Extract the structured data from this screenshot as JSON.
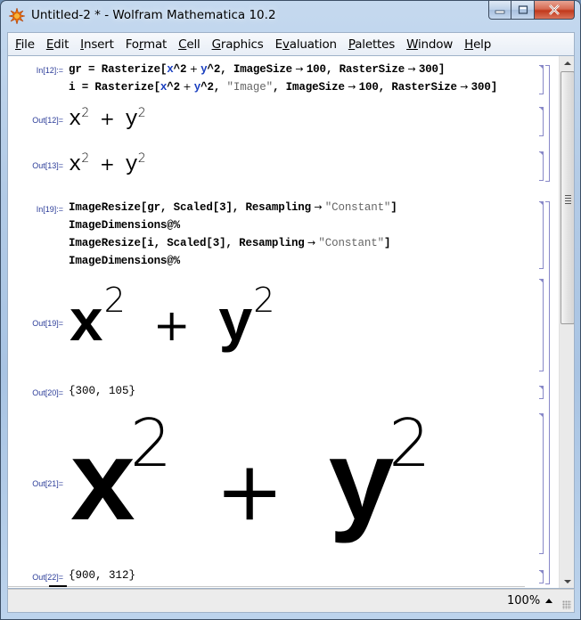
{
  "window": {
    "title": "Untitled-2 * - Wolfram Mathematica 10.2",
    "app_icon": "mathematica-spikey-icon",
    "controls": [
      "minimize",
      "maximize",
      "close"
    ]
  },
  "menubar": {
    "items": [
      {
        "label": "File",
        "mnemonic": "F"
      },
      {
        "label": "Edit",
        "mnemonic": "E"
      },
      {
        "label": "Insert",
        "mnemonic": "I"
      },
      {
        "label": "Format",
        "mnemonic": "r"
      },
      {
        "label": "Cell",
        "mnemonic": "C"
      },
      {
        "label": "Graphics",
        "mnemonic": "G"
      },
      {
        "label": "Evaluation",
        "mnemonic": "v"
      },
      {
        "label": "Palettes",
        "mnemonic": "P"
      },
      {
        "label": "Window",
        "mnemonic": "W"
      },
      {
        "label": "Help",
        "mnemonic": "H"
      }
    ]
  },
  "notebook": {
    "cells": {
      "in12": {
        "label": "In[12]:=",
        "lines": [
          "gr = Rasterize[x^2 + y^2, ImageSize → 100, RasterSize → 300]",
          "i = Rasterize[x^2 + y^2, \"Image\", ImageSize → 100, RasterSize → 300]"
        ]
      },
      "out12": {
        "label": "Out[12]=",
        "expr": "x^2 + y^2",
        "var1": "x",
        "var2": "y",
        "exp": "2",
        "plus": "+"
      },
      "out13": {
        "label": "Out[13]=",
        "expr": "x^2 + y^2",
        "var1": "x",
        "var2": "y",
        "exp": "2",
        "plus": "+"
      },
      "in19": {
        "label": "In[19]:=",
        "lines": [
          "ImageResize[gr, Scaled[3], Resampling → \"Constant\"]",
          "ImageDimensions@%",
          "ImageResize[i, Scaled[3], Resampling → \"Constant\"]",
          "ImageDimensions@%"
        ]
      },
      "out19": {
        "label": "Out[19]=",
        "expr": "x^2 + y^2",
        "var1": "x",
        "var2": "y",
        "exp": "2",
        "plus": "+"
      },
      "out20": {
        "label": "Out[20]=",
        "value": "{300, 105}"
      },
      "out21": {
        "label": "Out[21]=",
        "expr": "x^2 + y^2",
        "var1": "x",
        "var2": "y",
        "exp": "2",
        "plus": "+"
      },
      "out22": {
        "label": "Out[22]=",
        "value": "{900, 312}"
      }
    }
  },
  "statusbar": {
    "zoom": "100%"
  },
  "colors": {
    "cell_label": "#2c3d99",
    "symbol_blue": "#1a3fbf",
    "string_gray": "#666666",
    "bracket": "#8888c8"
  }
}
